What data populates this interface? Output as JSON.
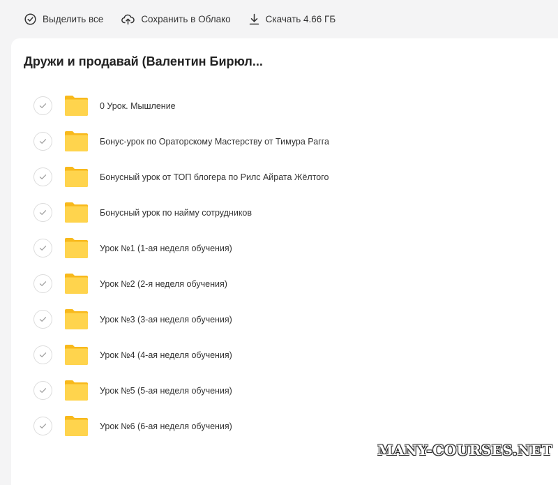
{
  "toolbar": {
    "select_all": "Выделить все",
    "save_cloud": "Сохранить в Облако",
    "download": "Скачать 4.66 ГБ"
  },
  "folder": {
    "title": "Дружи и продавай (Валентин Бирюл..."
  },
  "items": [
    {
      "label": "0 Урок. Мышление"
    },
    {
      "label": "Бонус-урок по Ораторскому Мастерству от Тимура Рагга"
    },
    {
      "label": "Бонусный урок от ТОП блогера по Рилс Айрата Жёлтого"
    },
    {
      "label": "Бонусный урок по найму сотрудников"
    },
    {
      "label": "Урок №1 (1-ая неделя обучения)"
    },
    {
      "label": "Урок №2 (2-я неделя обучения)"
    },
    {
      "label": "Урок №3 (3-ая неделя обучения)"
    },
    {
      "label": "Урок №4 (4-ая неделя обучения)"
    },
    {
      "label": "Урок №5 (5-ая неделя обучения)"
    },
    {
      "label": "Урок №6 (6-ая неделя обучения)"
    }
  ],
  "watermark": "MANY-COURSES.NET",
  "colors": {
    "folder_back": "#f8b91c",
    "folder_front": "#ffd44d",
    "check_mark": "#a0a0a0",
    "page_background": "#f4f4f5"
  },
  "icons": {
    "select_all": "check-circle-icon",
    "save_cloud": "cloud-upload-icon",
    "download": "download-icon",
    "row_check": "check-circle-icon",
    "row_folder": "folder-icon"
  }
}
